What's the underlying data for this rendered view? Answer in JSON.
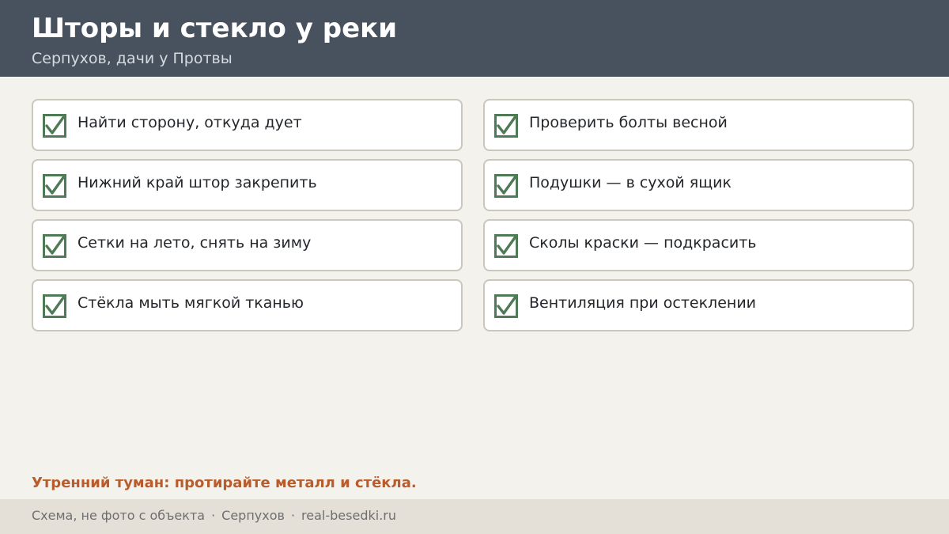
{
  "header": {
    "title": "Шторы и стекло у реки",
    "subtitle": "Серпухов, дачи у Протвы"
  },
  "checklist": {
    "items": [
      {
        "label": "Найти сторону, откуда дует",
        "checked": true
      },
      {
        "label": "Проверить болты весной",
        "checked": true
      },
      {
        "label": "Нижний край штор закрепить",
        "checked": true
      },
      {
        "label": "Подушки — в сухой ящик",
        "checked": true
      },
      {
        "label": "Сетки на лето, снять на зиму",
        "checked": true
      },
      {
        "label": "Сколы краски — подкрасить",
        "checked": true
      },
      {
        "label": "Стёкла мыть мягкой тканью",
        "checked": true
      },
      {
        "label": "Вентиляция при остеклении",
        "checked": true
      }
    ],
    "check_color": "#4e7a55"
  },
  "note": "Утренний туман: протирайте металл и стёкла.",
  "footer": {
    "part1": "Схема, не фото с объекта",
    "separator": "·",
    "part2": "Серпухов",
    "part3": "real-besedki.ru"
  },
  "colors": {
    "header_bg": "#48525e",
    "page_bg": "#f4f2ed",
    "note": "#b95c2c",
    "footer_bg": "#e4e0d8"
  }
}
